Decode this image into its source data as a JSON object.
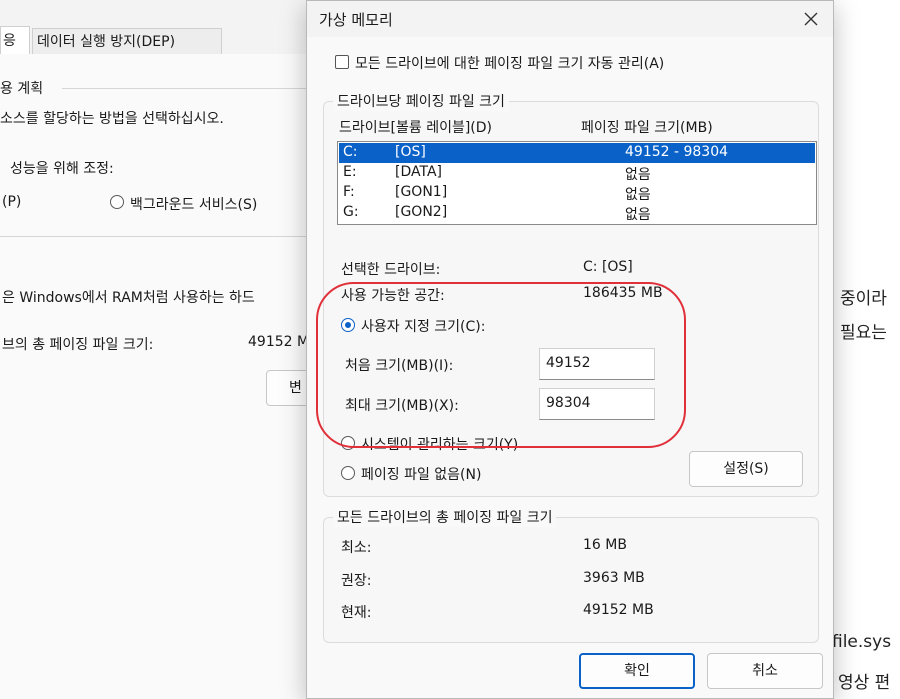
{
  "background_window": {
    "tab_active_partial": "응",
    "tab_dep": "데이터 실행 방지(DEP)",
    "section_title": "용 계획",
    "description": "소스를 할당하는 방법을 선택하십시오.",
    "adjust_label": "성능을 위해 조정:",
    "programs_option": "(P)",
    "background_services_option": "백그라운드 서비스(S)",
    "virtual_memory_text": "은 Windows에서 RAM처럼 사용하는 하드",
    "total_paging_label": "브의 총 페이징 파일 크기:",
    "total_paging_value": "49152 M",
    "change_button_partial": "변"
  },
  "blog_text": {
    "line1": "중이라",
    "line2": "필요는",
    "line3": "file.sys",
    "line4": "영상 편"
  },
  "dialog": {
    "title": "가상 메모리",
    "auto_manage_label": "모든 드라이브에 대한 페이징 파일 크기 자동 관리(A)",
    "auto_manage_checked": false,
    "per_drive_group_title": "드라이브당 페이징 파일 크기",
    "drive_column_header": "드라이브[볼륨 레이블](D)",
    "size_column_header": "페이징 파일 크기(MB)",
    "drives": [
      {
        "letter": "C:",
        "label": "[OS]",
        "size": "49152 - 98304",
        "selected": true
      },
      {
        "letter": "E:",
        "label": "[DATA]",
        "size": "없음",
        "selected": false
      },
      {
        "letter": "F:",
        "label": "[GON1]",
        "size": "없음",
        "selected": false
      },
      {
        "letter": "G:",
        "label": "[GON2]",
        "size": "없음",
        "selected": false
      }
    ],
    "selected_drive_label": "선택한 드라이브:",
    "selected_drive_value": "C:  [OS]",
    "available_space_label": "사용 가능한 공간:",
    "available_space_value": "186435 MB",
    "custom_size_label": "사용자 지정 크기(C):",
    "initial_size_label": "처음 크기(MB)(I):",
    "initial_size_value": "49152",
    "max_size_label": "최대 크기(MB)(X):",
    "max_size_value": "98304",
    "system_managed_label": "시스템이 관리하는 크기(Y)",
    "no_paging_label": "페이징 파일 없음(N)",
    "selected_option": "custom",
    "set_button": "설정(S)",
    "totals_group_title": "모든 드라이브의 총 페이징 파일 크기",
    "minimum_label": "최소:",
    "minimum_value": "16 MB",
    "recommended_label": "권장:",
    "recommended_value": "3963 MB",
    "current_label": "현재:",
    "current_value": "49152 MB",
    "ok_button": "확인",
    "cancel_button": "취소"
  },
  "colors": {
    "accent": "#0a62c9",
    "highlight_annotation": "#e0303a"
  }
}
